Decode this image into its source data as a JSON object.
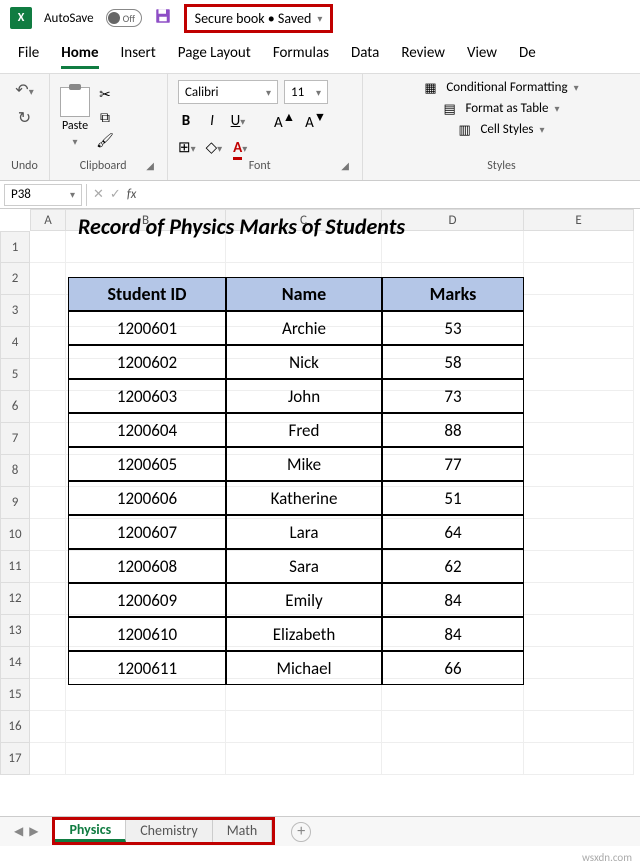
{
  "titlebar": {
    "autosave_label": "AutoSave",
    "autosave_state": "Off",
    "filename": "Secure book • Saved"
  },
  "main_tabs": [
    "File",
    "Home",
    "Insert",
    "Page Layout",
    "Formulas",
    "Data",
    "Review",
    "View",
    "De"
  ],
  "ribbon": {
    "undo_label": "Undo",
    "paste_label": "Paste",
    "clipboard_label": "Clipboard",
    "font_name": "Calibri",
    "font_size": "11",
    "font_label": "Font",
    "cond_fmt": "Conditional Formatting",
    "fmt_table": "Format as Table",
    "cell_styles": "Cell Styles",
    "styles_label": "Styles"
  },
  "name_box": "P38",
  "col_headers": [
    "A",
    "B",
    "C",
    "D",
    "E"
  ],
  "row_headers": [
    "1",
    "2",
    "3",
    "4",
    "5",
    "6",
    "7",
    "8",
    "9",
    "10",
    "11",
    "12",
    "13",
    "14",
    "15",
    "16",
    "17"
  ],
  "title": "Record of Physics Marks of Students",
  "table": {
    "headers": [
      "Student ID",
      "Name",
      "Marks"
    ],
    "rows": [
      [
        "1200601",
        "Archie",
        "53"
      ],
      [
        "1200602",
        "Nick",
        "58"
      ],
      [
        "1200603",
        "John",
        "73"
      ],
      [
        "1200604",
        "Fred",
        "88"
      ],
      [
        "1200605",
        "Mike",
        "77"
      ],
      [
        "1200606",
        "Katherine",
        "51"
      ],
      [
        "1200607",
        "Lara",
        "64"
      ],
      [
        "1200608",
        "Sara",
        "62"
      ],
      [
        "1200609",
        "Emily",
        "84"
      ],
      [
        "1200610",
        "Elizabeth",
        "84"
      ],
      [
        "1200611",
        "Michael",
        "66"
      ]
    ]
  },
  "sheet_tabs": [
    "Physics",
    "Chemistry",
    "Math"
  ],
  "watermark": "wsxdn.com"
}
